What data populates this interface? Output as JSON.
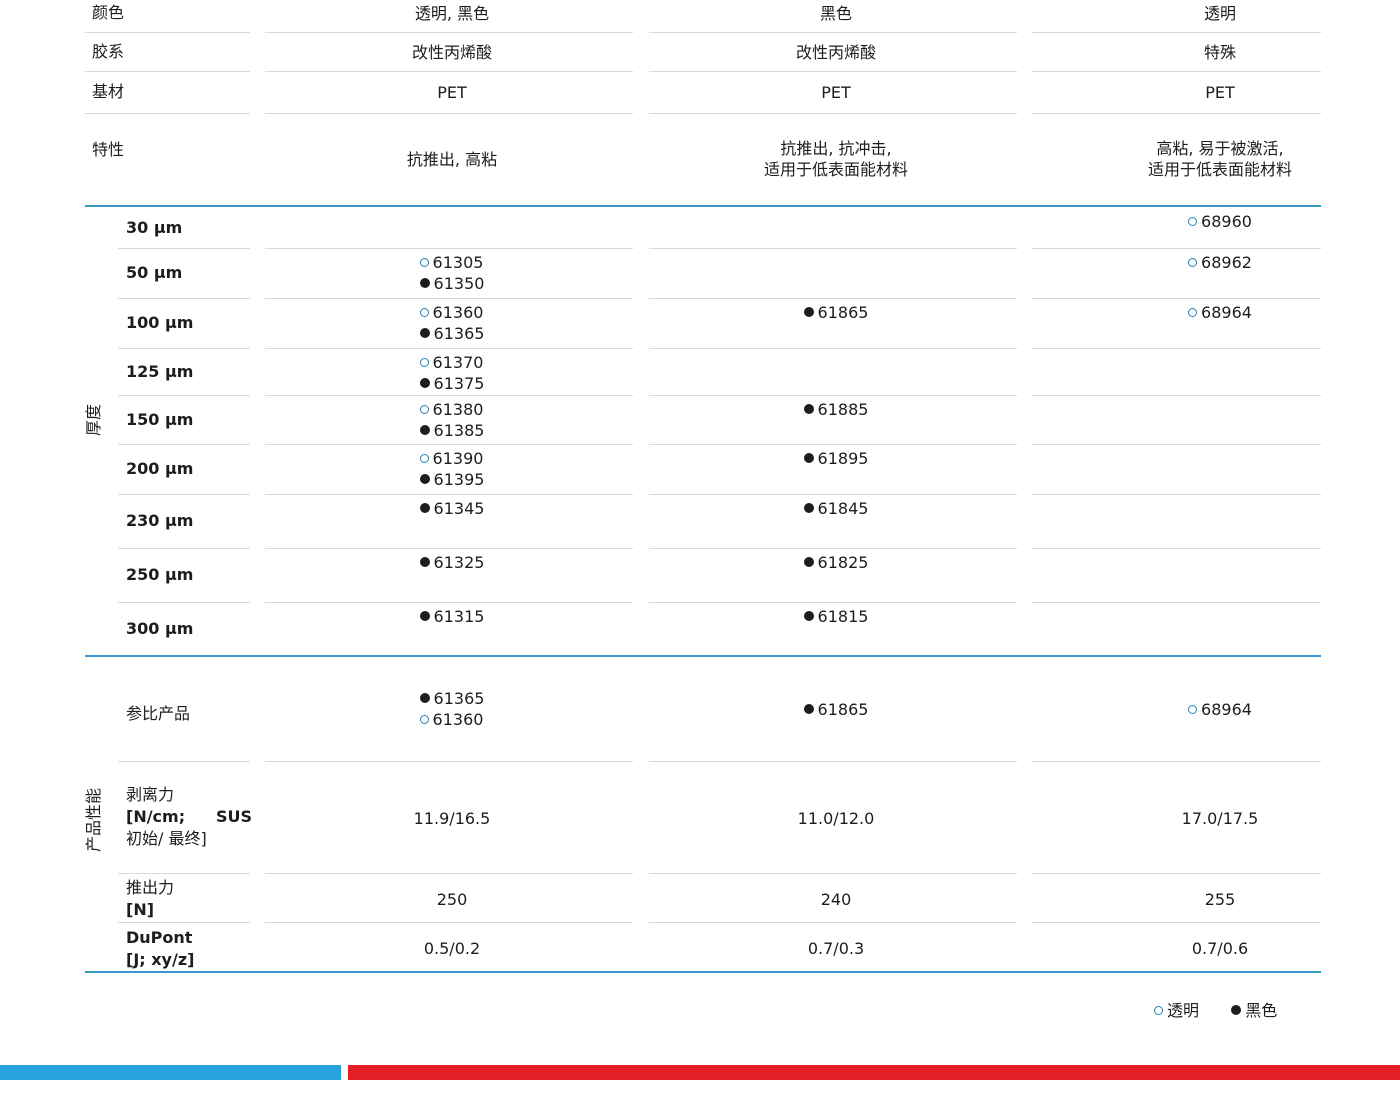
{
  "properties": {
    "color": {
      "label": "颜色",
      "values": [
        "透明, 黑色",
        "黑色",
        "透明"
      ]
    },
    "adhesive": {
      "label": "胶系",
      "values": [
        "改性丙烯酸",
        "改性丙烯酸",
        "特殊"
      ]
    },
    "substrate": {
      "label": "基材",
      "values": [
        "PET",
        "PET",
        "PET"
      ]
    },
    "features": {
      "label": "特性",
      "values": [
        [
          "抗推出, 高粘"
        ],
        [
          "抗推出, 抗冲击,",
          "适用于低表面能材料"
        ],
        [
          "高粘, 易于被激活,",
          "适用于低表面能材料"
        ]
      ]
    }
  },
  "thickness_group_label": "厚度",
  "thickness_rows": [
    {
      "label": "30 μm",
      "cells": [
        [],
        [],
        [
          {
            "type": "clear",
            "code": "68960"
          }
        ]
      ]
    },
    {
      "label": "50 μm",
      "cells": [
        [
          {
            "type": "clear",
            "code": "61305"
          },
          {
            "type": "black",
            "code": "61350"
          }
        ],
        [],
        [
          {
            "type": "clear",
            "code": "68962"
          }
        ]
      ]
    },
    {
      "label": "100 μm",
      "cells": [
        [
          {
            "type": "clear",
            "code": "61360"
          },
          {
            "type": "black",
            "code": "61365"
          }
        ],
        [
          {
            "type": "black",
            "code": "61865"
          }
        ],
        [
          {
            "type": "clear",
            "code": "68964"
          }
        ]
      ]
    },
    {
      "label": "125 μm",
      "cells": [
        [
          {
            "type": "clear",
            "code": "61370"
          },
          {
            "type": "black",
            "code": "61375"
          }
        ],
        [],
        []
      ]
    },
    {
      "label": "150 μm",
      "cells": [
        [
          {
            "type": "clear",
            "code": "61380"
          },
          {
            "type": "black",
            "code": "61385"
          }
        ],
        [
          {
            "type": "black",
            "code": "61885"
          }
        ],
        []
      ]
    },
    {
      "label": "200 μm",
      "cells": [
        [
          {
            "type": "clear",
            "code": "61390"
          },
          {
            "type": "black",
            "code": "61395"
          }
        ],
        [
          {
            "type": "black",
            "code": "61895"
          }
        ],
        []
      ]
    },
    {
      "label": "230 μm",
      "cells": [
        [
          {
            "type": "black",
            "code": "61345"
          }
        ],
        [
          {
            "type": "black",
            "code": "61845"
          }
        ],
        []
      ]
    },
    {
      "label": "250 μm",
      "cells": [
        [
          {
            "type": "black",
            "code": "61325"
          }
        ],
        [
          {
            "type": "black",
            "code": "61825"
          }
        ],
        []
      ]
    },
    {
      "label": "300 μm",
      "cells": [
        [
          {
            "type": "black",
            "code": "61315"
          }
        ],
        [
          {
            "type": "black",
            "code": "61815"
          }
        ],
        []
      ]
    }
  ],
  "performance_group_label": "产品性能",
  "performance": {
    "reference": {
      "label": "参比产品",
      "cells": [
        [
          {
            "type": "black",
            "code": "61365"
          },
          {
            "type": "clear",
            "code": "61360"
          }
        ],
        [
          {
            "type": "black",
            "code": "61865"
          }
        ],
        [
          {
            "type": "clear",
            "code": "68964"
          }
        ]
      ]
    },
    "peel": {
      "label_line1": "剥离力",
      "label_line2a": "[N/cm;",
      "label_line2b": "SUS",
      "label_line3": "初始/ 最终]",
      "values": [
        "11.9/16.5",
        "11.0/12.0",
        "17.0/17.5"
      ]
    },
    "pushout": {
      "label_line1": "推出力",
      "label_line2": "[N]",
      "values": [
        "250",
        "240",
        "255"
      ]
    },
    "dupont": {
      "label_line1": "DuPont",
      "label_line2": "[J; xy/z]",
      "values": [
        "0.5/0.2",
        "0.7/0.3",
        "0.7/0.6"
      ]
    }
  },
  "legend": {
    "clear": "透明",
    "black": "黑色"
  },
  "colors": {
    "accent_blue": "#3a97c9",
    "bar_blue": "#29a3dd",
    "bar_red": "#e41f25",
    "ring": "#2d7fb0"
  },
  "icons": {
    "clear": "hollow-circle-icon",
    "black": "filled-circle-icon"
  }
}
